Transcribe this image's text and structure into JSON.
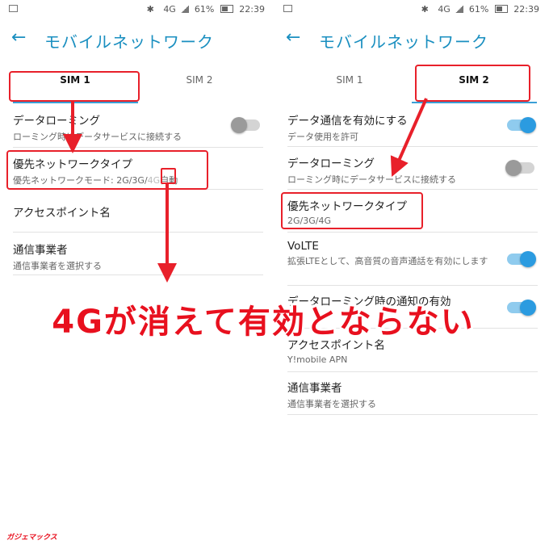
{
  "status_bar": {
    "net": "4G",
    "battery": "61%",
    "time": "22:39"
  },
  "app_bar": {
    "title": "モバイルネットワーク"
  },
  "left": {
    "tabs": [
      "SIM 1",
      "SIM 2"
    ],
    "items": [
      {
        "title": "データローミング",
        "subtitle": "ローミング時にデータサービスに接続する",
        "toggle": "off"
      },
      {
        "title": "優先ネットワークタイプ",
        "subtitle_pre": "優先ネットワークモード: 2G/3G/",
        "subtitle_mark": "4G",
        "subtitle_post": "自動"
      },
      {
        "title": "アクセスポイント名"
      },
      {
        "title": "通信事業者",
        "subtitle": "通信事業者を選択する"
      }
    ]
  },
  "right": {
    "tabs": [
      "SIM 1",
      "SIM 2"
    ],
    "items": [
      {
        "title": "データ通信を有効にする",
        "subtitle": "データ使用を許可",
        "toggle": "on"
      },
      {
        "title": "データローミング",
        "subtitle": "ローミング時にデータサービスに接続する",
        "toggle": "off"
      },
      {
        "title": "優先ネットワークタイプ",
        "subtitle": "2G/3G/4G"
      },
      {
        "title": "VoLTE",
        "subtitle": "拡張LTEとして、高音質の音声通話を有効にします",
        "toggle": "on"
      },
      {
        "title": "データローミング時の通知の有効",
        "toggle": "on"
      },
      {
        "title": "アクセスポイント名",
        "subtitle": "Y!mobile APN"
      },
      {
        "title": "通信事業者",
        "subtitle": "通信事業者を選択する"
      }
    ]
  },
  "banner": "4Gが消えて有効とならない",
  "watermark": "ガジェマックス",
  "colors": {
    "accent": "#1a8fc0",
    "annotation_red": "#e8202a",
    "toggle_on": "#2b9be0"
  }
}
